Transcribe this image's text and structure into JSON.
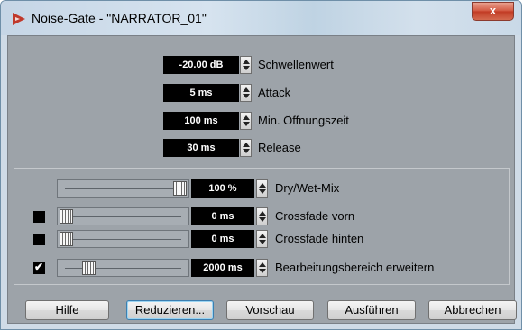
{
  "window": {
    "title": "Noise-Gate - \"NARRATOR_01\"",
    "close_label": "x"
  },
  "parameters": [
    {
      "value": "-20.00 dB",
      "label": "Schwellenwert"
    },
    {
      "value": "5 ms",
      "label": "Attack"
    },
    {
      "value": "100 ms",
      "label": "Min. Öffnungszeit"
    },
    {
      "value": "30 ms",
      "label": "Release"
    }
  ],
  "mix_controls": [
    {
      "value": "100 %",
      "label": "Dry/Wet-Mix",
      "has_checkbox": false,
      "slider_fraction": 1.0
    },
    {
      "value": "0 ms",
      "label": "Crossfade vorn",
      "checked": false,
      "slider_fraction": 0.0
    },
    {
      "value": "0 ms",
      "label": "Crossfade hinten",
      "checked": false,
      "slider_fraction": 0.0
    },
    {
      "value": "2000 ms",
      "label": "Bearbeitungsbereich erweitern",
      "checked": true,
      "checkmark": "✔",
      "slider_fraction": 0.2
    }
  ],
  "buttons": {
    "help": "Hilfe",
    "reduce": "Reduzieren...",
    "preview": "Vorschau",
    "execute": "Ausführen",
    "cancel": "Abbrechen"
  },
  "icons": {
    "app": "app-triangle-icon",
    "close": "close-icon"
  },
  "colors": {
    "app_icon": "#c0392b",
    "close_button": "#c8432b",
    "client_background": "#9da3a9"
  }
}
